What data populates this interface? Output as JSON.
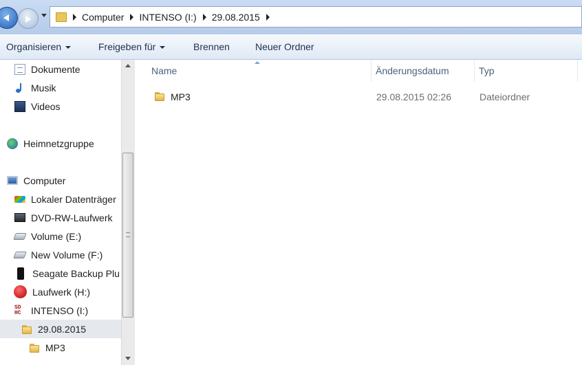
{
  "address_bar": {
    "crumbs": [
      "Computer",
      "INTENSO (I:)",
      "29.08.2015"
    ]
  },
  "toolbar": {
    "organize": "Organisieren",
    "share": "Freigeben für",
    "burn": "Brennen",
    "new_folder": "Neuer Ordner"
  },
  "navigation": {
    "items": [
      {
        "label": "Dokumente",
        "icon": "documents-icon"
      },
      {
        "label": "Musik",
        "icon": "music-icon"
      },
      {
        "label": "Videos",
        "icon": "videos-icon"
      },
      {
        "label": "Heimnetzgruppe",
        "icon": "homegroup-icon"
      },
      {
        "label": "Computer",
        "icon": "computer-icon"
      },
      {
        "label": "Lokaler Datenträger",
        "icon": "local-disk-icon"
      },
      {
        "label": "DVD-RW-Laufwerk",
        "icon": "dvd-drive-icon"
      },
      {
        "label": "Volume (E:)",
        "icon": "drive-icon"
      },
      {
        "label": "New Volume (F:)",
        "icon": "drive-icon"
      },
      {
        "label": "Seagate Backup Plu",
        "icon": "external-drive-icon"
      },
      {
        "label": "Laufwerk (H:)",
        "icon": "drive-h-icon"
      },
      {
        "label": "INTENSO (I:)",
        "icon": "sd-card-icon"
      },
      {
        "label": "29.08.2015",
        "icon": "folder-icon",
        "selected": true
      },
      {
        "label": "MP3",
        "icon": "folder-icon"
      }
    ]
  },
  "file_list": {
    "columns": {
      "name": "Name",
      "date": "Änderungsdatum",
      "type": "Typ"
    },
    "rows": [
      {
        "name": "MP3",
        "date": "29.08.2015 02:26",
        "type": "Dateiordner"
      }
    ]
  }
}
